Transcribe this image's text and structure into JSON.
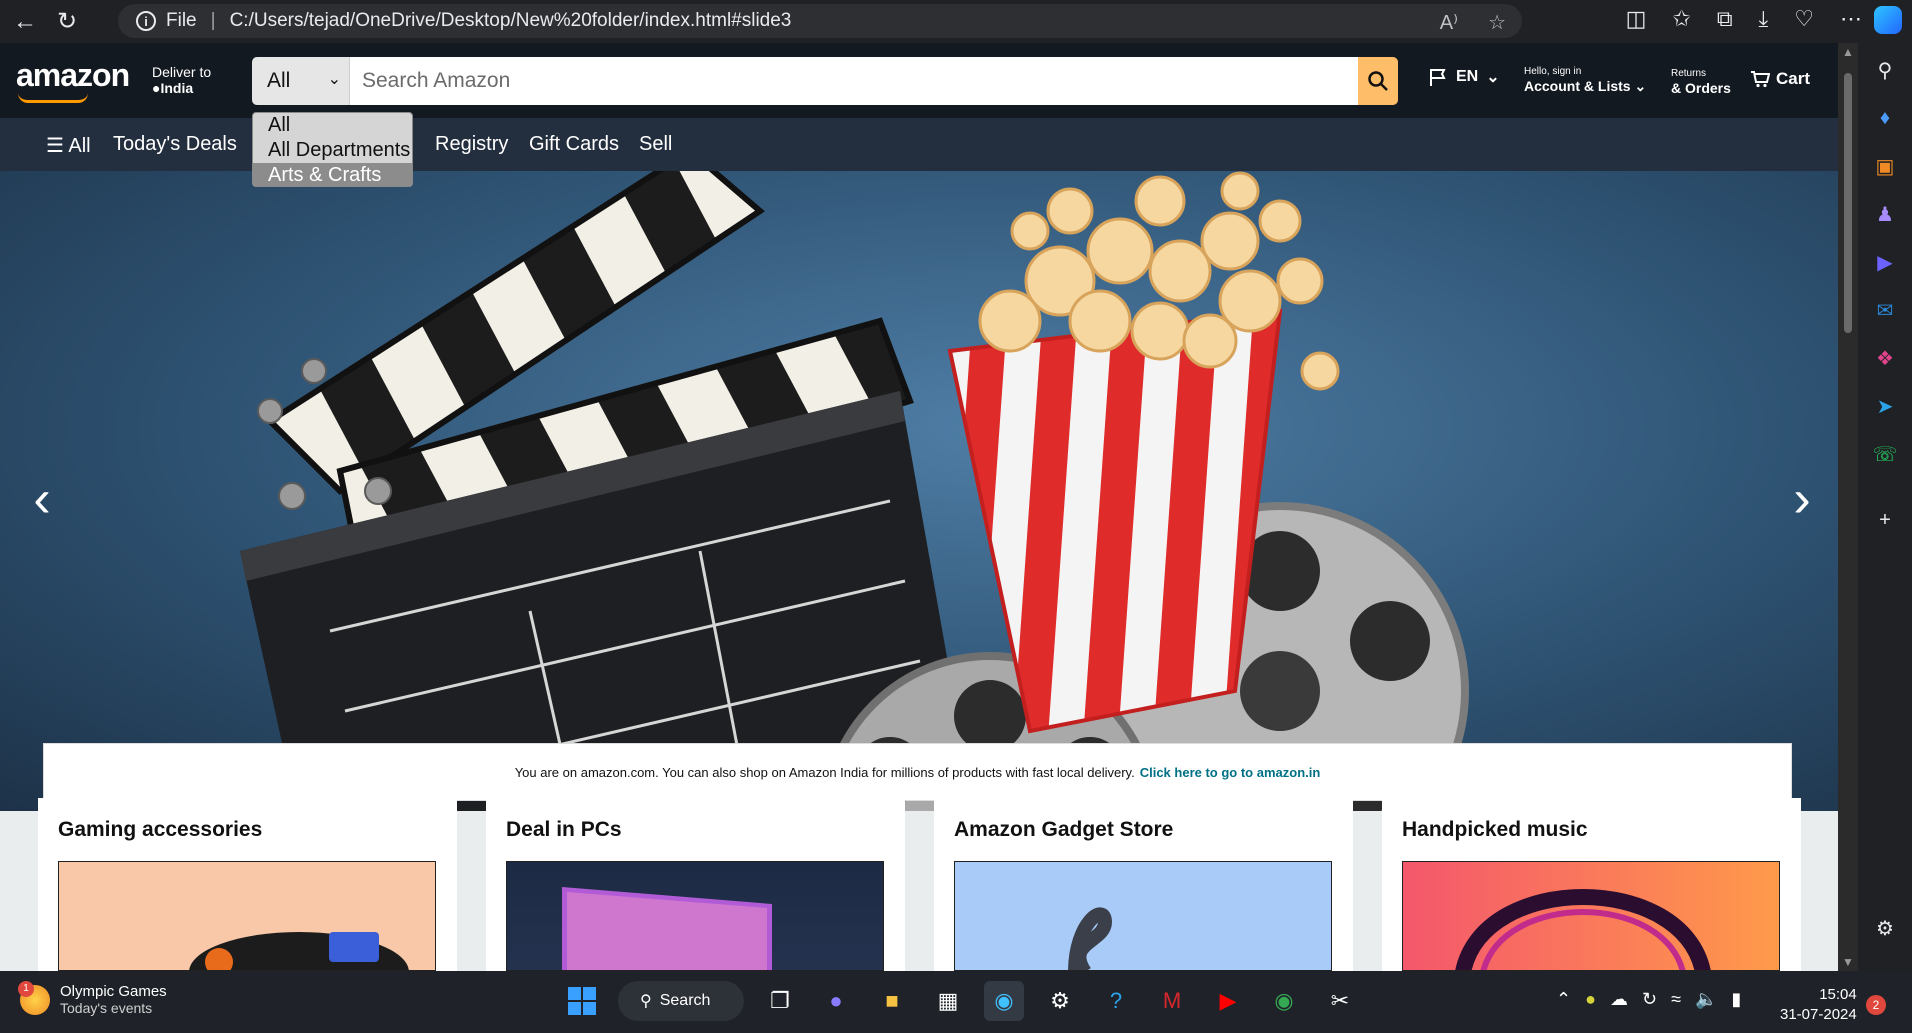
{
  "browser": {
    "file_label": "File",
    "url": "C:/Users/tejad/OneDrive/Desktop/New%20folder/index.html#slide3"
  },
  "header": {
    "logo": "amazon",
    "deliver_to": "Deliver to",
    "country": "India",
    "search_category": "All",
    "search_placeholder": "Search Amazon",
    "language": "EN",
    "account_line1": "Hello, sign in",
    "account_line2": "Account & Lists",
    "orders_line1": "Returns",
    "orders_line2": "& Orders",
    "cart": "Cart"
  },
  "subnav": {
    "all": "All",
    "items": [
      "Today's Deals",
      "Registry",
      "Gift Cards",
      "Sell"
    ]
  },
  "dropdown": {
    "options": [
      "All",
      "All Departments",
      "Arts & Crafts"
    ],
    "highlighted": "Arts & Crafts"
  },
  "notice": {
    "text": "You are on amazon.com. You can also shop on Amazon India for millions of products with fast local delivery.",
    "link": "Click here to go to amazon.in"
  },
  "cards": [
    {
      "title": "Gaming accessories"
    },
    {
      "title": "Deal in PCs"
    },
    {
      "title": "Amazon Gadget Store"
    },
    {
      "title": "Handpicked music"
    }
  ],
  "taskbar": {
    "widget_badge": "1",
    "widget_title": "Olympic Games",
    "widget_subtitle": "Today's events",
    "search": "Search",
    "time": "15:04",
    "date": "31-07-2024",
    "notifications": "2"
  },
  "colors": {
    "header_bg": "#131921",
    "subnav_bg": "#232f3e",
    "search_button": "#febd69",
    "link": "#007185",
    "logo_accent": "#ff9900"
  }
}
